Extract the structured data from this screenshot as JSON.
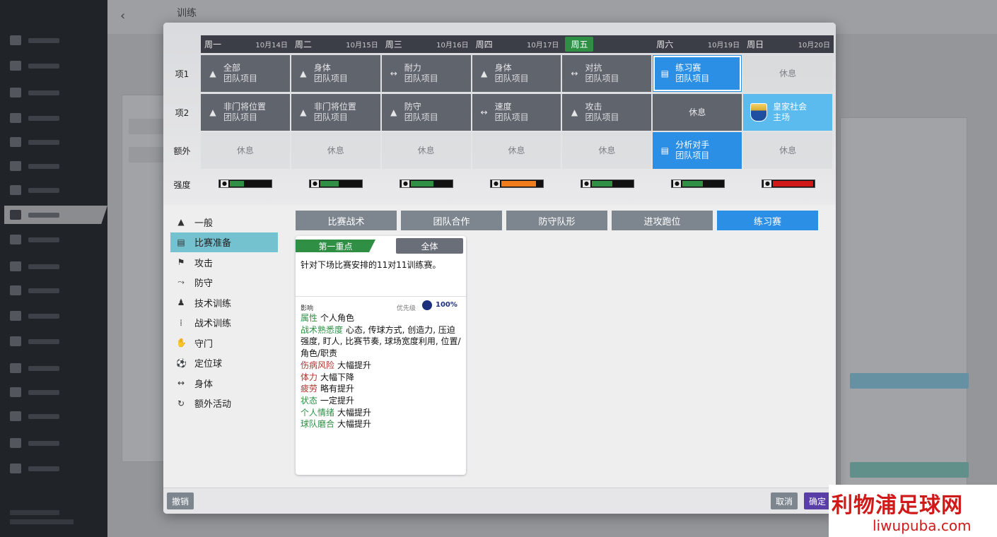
{
  "schedule": {
    "days": [
      {
        "name": "周一",
        "date": "10月14日",
        "today": false
      },
      {
        "name": "周二",
        "date": "10月15日",
        "today": false
      },
      {
        "name": "周三",
        "date": "10月16日",
        "today": false
      },
      {
        "name": "周四",
        "date": "10月17日",
        "today": false
      },
      {
        "name": "周五",
        "date": "",
        "today": true
      },
      {
        "name": "周六",
        "date": "10月19日",
        "today": false
      },
      {
        "name": "周日",
        "date": "10月20日",
        "today": false
      }
    ],
    "rows": [
      {
        "label": "项1",
        "slots": [
          {
            "t1": "全部",
            "t2": "团队项目",
            "icon": "cone-icon",
            "glyph": "▲",
            "style": "dark"
          },
          {
            "t1": "身体",
            "t2": "团队项目",
            "icon": "cone-icon",
            "glyph": "▲",
            "style": "dark"
          },
          {
            "t1": "耐力",
            "t2": "团队项目",
            "icon": "dumbbell-icon",
            "glyph": "↔",
            "style": "dark"
          },
          {
            "t1": "身体",
            "t2": "团队项目",
            "icon": "cone-icon",
            "glyph": "▲",
            "style": "dark"
          },
          {
            "t1": "对抗",
            "t2": "团队项目",
            "icon": "dumbbell-icon",
            "glyph": "↔",
            "style": "dark"
          },
          {
            "t1": "练习赛",
            "t2": "团队项目",
            "icon": "clipboard-icon",
            "glyph": "▤",
            "style": "sel"
          },
          {
            "t1": "休息",
            "t2": "",
            "icon": "",
            "glyph": "",
            "style": "rest"
          }
        ]
      },
      {
        "label": "项2",
        "slots": [
          {
            "t1": "非门将位置",
            "t2": "团队项目",
            "icon": "cone-icon",
            "glyph": "▲",
            "style": "dark"
          },
          {
            "t1": "非门将位置",
            "t2": "团队项目",
            "icon": "cone-icon",
            "glyph": "▲",
            "style": "dark"
          },
          {
            "t1": "防守",
            "t2": "团队项目",
            "icon": "cone-icon",
            "glyph": "▲",
            "style": "dark"
          },
          {
            "t1": "速度",
            "t2": "团队项目",
            "icon": "dumbbell-icon",
            "glyph": "↔",
            "style": "dark"
          },
          {
            "t1": "攻击",
            "t2": "团队项目",
            "icon": "cone-icon",
            "glyph": "▲",
            "style": "dark"
          },
          {
            "t1": "休息",
            "t2": "",
            "icon": "",
            "glyph": "",
            "style": "rest-dark"
          },
          {
            "t1": "皇家社会",
            "t2": "主场",
            "icon": "club-crest-icon",
            "glyph": "",
            "style": "light"
          }
        ]
      },
      {
        "label": "额外",
        "slots": [
          {
            "t1": "休息",
            "t2": "",
            "icon": "",
            "glyph": "",
            "style": "rest"
          },
          {
            "t1": "休息",
            "t2": "",
            "icon": "",
            "glyph": "",
            "style": "rest"
          },
          {
            "t1": "休息",
            "t2": "",
            "icon": "",
            "glyph": "",
            "style": "rest"
          },
          {
            "t1": "休息",
            "t2": "",
            "icon": "",
            "glyph": "",
            "style": "rest"
          },
          {
            "t1": "休息",
            "t2": "",
            "icon": "",
            "glyph": "",
            "style": "rest"
          },
          {
            "t1": "分析对手",
            "t2": "团队项目",
            "icon": "clipboard-icon",
            "glyph": "▤",
            "style": "blue"
          },
          {
            "t1": "休息",
            "t2": "",
            "icon": "",
            "glyph": "",
            "style": "rest"
          }
        ]
      }
    ],
    "intensity_label": "强度",
    "intensity": [
      {
        "level": 0.35,
        "color": "#2f8f45"
      },
      {
        "level": 0.45,
        "color": "#2f8f45"
      },
      {
        "level": 0.55,
        "color": "#2f8f45"
      },
      {
        "level": 0.85,
        "color": "#f07c1c"
      },
      {
        "level": 0.5,
        "color": "#2f8f45"
      },
      {
        "level": 0.5,
        "color": "#2f8f45"
      },
      {
        "level": 0.98,
        "color": "#d01818"
      }
    ]
  },
  "categories": [
    {
      "label": "一般",
      "icon": "cone-icon",
      "glyph": "▲",
      "active": false
    },
    {
      "label": "比赛准备",
      "icon": "clipboard-icon",
      "glyph": "▤",
      "active": true
    },
    {
      "label": "攻击",
      "icon": "runner-icon",
      "glyph": "⚑",
      "active": false
    },
    {
      "label": "防守",
      "icon": "slide-tackle-icon",
      "glyph": "⤳",
      "active": false
    },
    {
      "label": "技术训练",
      "icon": "kick-icon",
      "glyph": "♟",
      "active": false
    },
    {
      "label": "战术训练",
      "icon": "tactics-icon",
      "glyph": "⁞",
      "active": false
    },
    {
      "label": "守门",
      "icon": "goalkeeper-icon",
      "glyph": "✋",
      "active": false
    },
    {
      "label": "定位球",
      "icon": "set-piece-icon",
      "glyph": "⚽",
      "active": false
    },
    {
      "label": "身体",
      "icon": "dumbbell-icon",
      "glyph": "↔",
      "active": false
    },
    {
      "label": "额外活动",
      "icon": "extra-activity-icon",
      "glyph": "↻",
      "active": false
    }
  ],
  "tabs": [
    {
      "label": "比赛战术",
      "active": false
    },
    {
      "label": "团队合作",
      "active": false
    },
    {
      "label": "防守队形",
      "active": false
    },
    {
      "label": "进攻跑位",
      "active": false
    },
    {
      "label": "练习赛",
      "active": true
    }
  ],
  "card": {
    "focus": "第一重点",
    "scope": "全体",
    "description": "针对下场比赛安排的11对11训练赛。",
    "impact_label": "影响",
    "priority_label": "优先级",
    "priority_value": "100%",
    "effects": [
      {
        "key": "属性",
        "value": "个人角色",
        "tone": "pos"
      },
      {
        "key": "战术熟悉度",
        "value": "心态, 传球方式, 创造力, 压迫强度, 盯人, 比赛节奏, 球场宽度利用, 位置/角色/职责",
        "tone": "pos"
      },
      {
        "key": "伤病风险",
        "value": "大幅提升",
        "tone": "neg"
      },
      {
        "key": "体力",
        "value": "大幅下降",
        "tone": "neg"
      },
      {
        "key": "疲劳",
        "value": "略有提升",
        "tone": "neg"
      },
      {
        "key": "状态",
        "value": "一定提升",
        "tone": "pos"
      },
      {
        "key": "个人情绪",
        "value": "大幅提升",
        "tone": "pos"
      },
      {
        "key": "球队磨合",
        "value": "大幅提升",
        "tone": "pos"
      }
    ]
  },
  "footer": {
    "undo": "撤销",
    "cancel": "取消",
    "ok": "确定"
  },
  "background": {
    "title": "训练"
  },
  "watermark": {
    "title": "利物浦足球网",
    "url": "liwupuba.com"
  }
}
